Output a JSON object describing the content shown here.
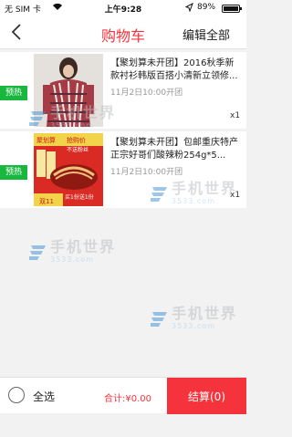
{
  "status_bar": {
    "carrier": "无 SIM 卡",
    "time": "上午9:28",
    "battery": "89%"
  },
  "nav": {
    "title": "购物车",
    "edit_label": "编辑全部"
  },
  "items": [
    {
      "tag": "预热",
      "description": "【聚划算未开团】2016秋季新款衬衫韩版百搭小清新立领修...",
      "time": "11月2日10:00开团",
      "qty": "x1"
    },
    {
      "tag": "预热",
      "description": "【聚划算未开团】包邮重庆特产正宗好哥们酸辣粉254g*5...",
      "time": "11月2日10:00开团",
      "qty": "x1",
      "thumb_lines": [
        "聚划算",
        "抢购价",
        "不送粉丝",
        "买1份送1份",
        "双11"
      ]
    }
  ],
  "watermark": {
    "name": "手机世界",
    "number": "3533.com"
  },
  "bottom": {
    "select_all": "全选",
    "total": "合计:¥0.00",
    "checkout": "结算(0)"
  },
  "colors": {
    "accent": "#f4333c",
    "tag": "#17b83d"
  }
}
